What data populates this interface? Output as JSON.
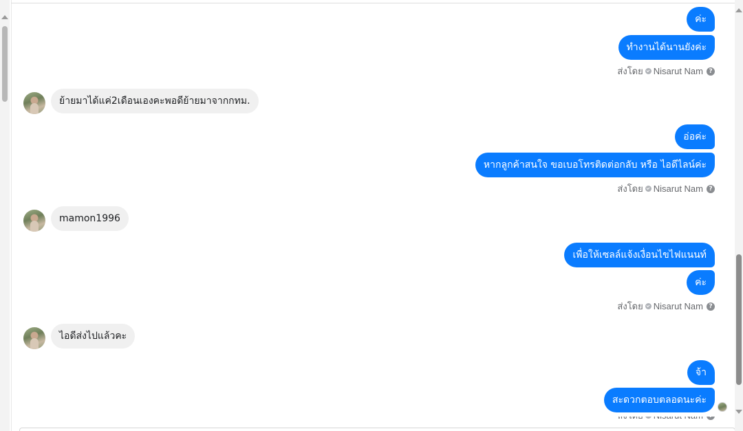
{
  "chat": {
    "sent_by_prefix": "ส่งโดย",
    "sender_name": "Nisarut Nam",
    "help_glyph": "?",
    "messages": [
      {
        "dir": "out",
        "text": "ค่ะ"
      },
      {
        "dir": "out",
        "text": "ทำงานได้นานยังค่ะ"
      },
      {
        "dir": "in",
        "text": "ย้ายมาได้แค่2เดือนเองคะพอดีย้ายมาจากกทม."
      },
      {
        "dir": "out",
        "text": "อ่อค่ะ"
      },
      {
        "dir": "out",
        "text": "หากลูกค้าสนใจ ขอเบอโทรติดต่อกลับ หรือ ไอดีไลน์ค่ะ"
      },
      {
        "dir": "in",
        "text": "mamon1996"
      },
      {
        "dir": "out",
        "text": "เพื่อให้เซลล์แจ้งเงื่อนไขไฟแนนท์"
      },
      {
        "dir": "out",
        "text": "ค่ะ"
      },
      {
        "dir": "in",
        "text": "ไอดีส่งไปแล้วคะ"
      },
      {
        "dir": "out",
        "text": "จ้า"
      },
      {
        "dir": "out",
        "text": "สะดวกตอบตลอดนะค่ะ"
      }
    ]
  },
  "colors": {
    "outgoing_bubble": "#0a7cff",
    "incoming_bubble": "#f0f0f0",
    "meta_text": "#65676b"
  },
  "icons": {
    "sender_check": "check-circle-icon",
    "help": "question-circle-icon",
    "avatar": "user-avatar",
    "seen": "seen-avatar"
  }
}
